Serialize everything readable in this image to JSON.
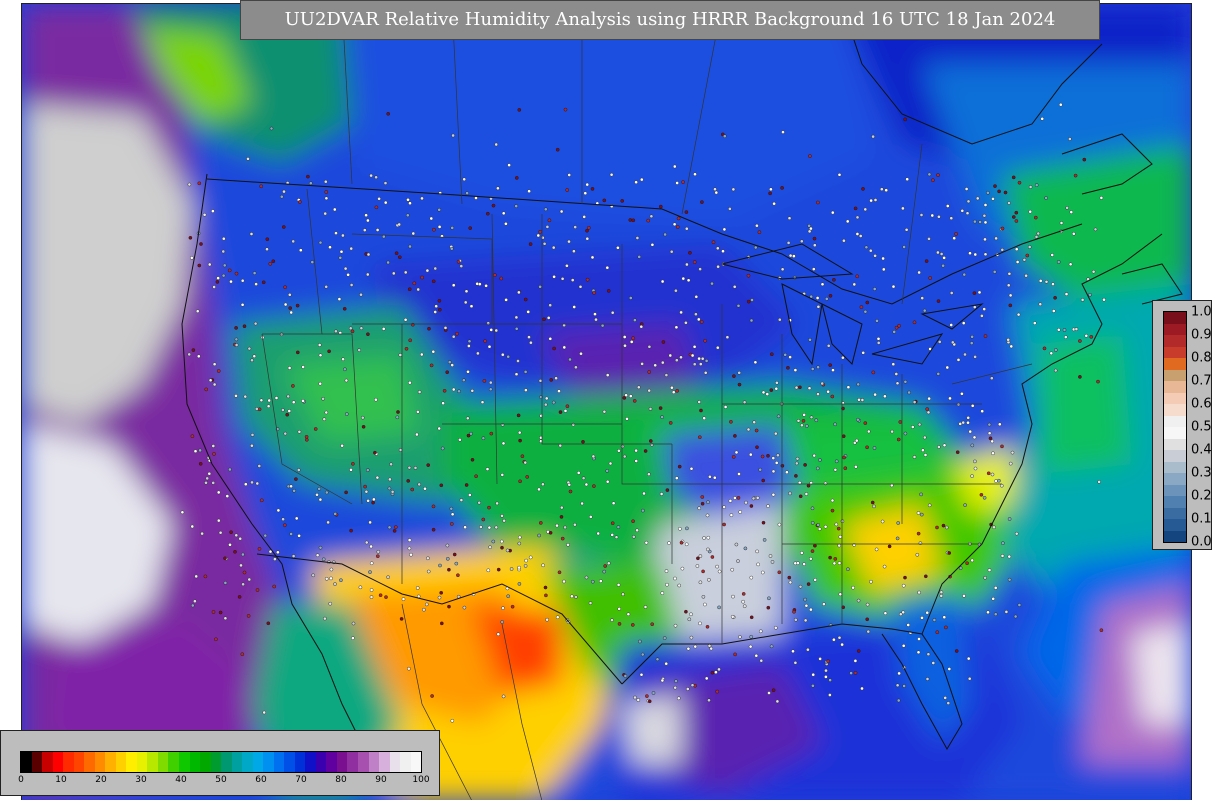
{
  "title": "UU2DVAR Relative Humidity Analysis using HRRR Background 16 UTC 18 Jan 2024",
  "rh_colorbar": {
    "ticks": [
      "0",
      "10",
      "20",
      "30",
      "40",
      "50",
      "60",
      "70",
      "80",
      "90",
      "100"
    ],
    "colors": [
      "#000000",
      "#5a0000",
      "#c80000",
      "#ff0000",
      "#ff2a00",
      "#ff4400",
      "#ff6a00",
      "#ff8c00",
      "#ffb000",
      "#ffd000",
      "#ffee00",
      "#e6f000",
      "#b8e800",
      "#80dc00",
      "#40d000",
      "#10c800",
      "#00b800",
      "#00a800",
      "#009c30",
      "#009870",
      "#00a0a0",
      "#00a8c8",
      "#00a8e8",
      "#0090f0",
      "#0070f0",
      "#0050e8",
      "#0030d8",
      "#1010c8",
      "#3a00b0",
      "#6000a0",
      "#7a1090",
      "#9030a0",
      "#a850b0",
      "#c080c8",
      "#d8b0dc",
      "#e8e0ea",
      "#f0f0f0",
      "#f8f8f8"
    ]
  },
  "station_error_colorbar": {
    "ticks": [
      "1.0",
      "0.9",
      "0.8",
      "0.7",
      "0.6",
      "0.5",
      "0.4",
      "0.3",
      "0.2",
      "0.1",
      "0.0"
    ],
    "colors": [
      "#7a0f1c",
      "#9c1a24",
      "#b22a2a",
      "#c83c2c",
      "#e06a20",
      "#c8a070",
      "#e8b896",
      "#f4cbb4",
      "#f6dccc",
      "#f0f0f0",
      "#f7f7f7",
      "#e0e0e0",
      "#c9ced6",
      "#a8bccc",
      "#8aa8c4",
      "#6c94bb",
      "#4f80b0",
      "#3a6ca2",
      "#255a94",
      "#15457e"
    ]
  }
}
